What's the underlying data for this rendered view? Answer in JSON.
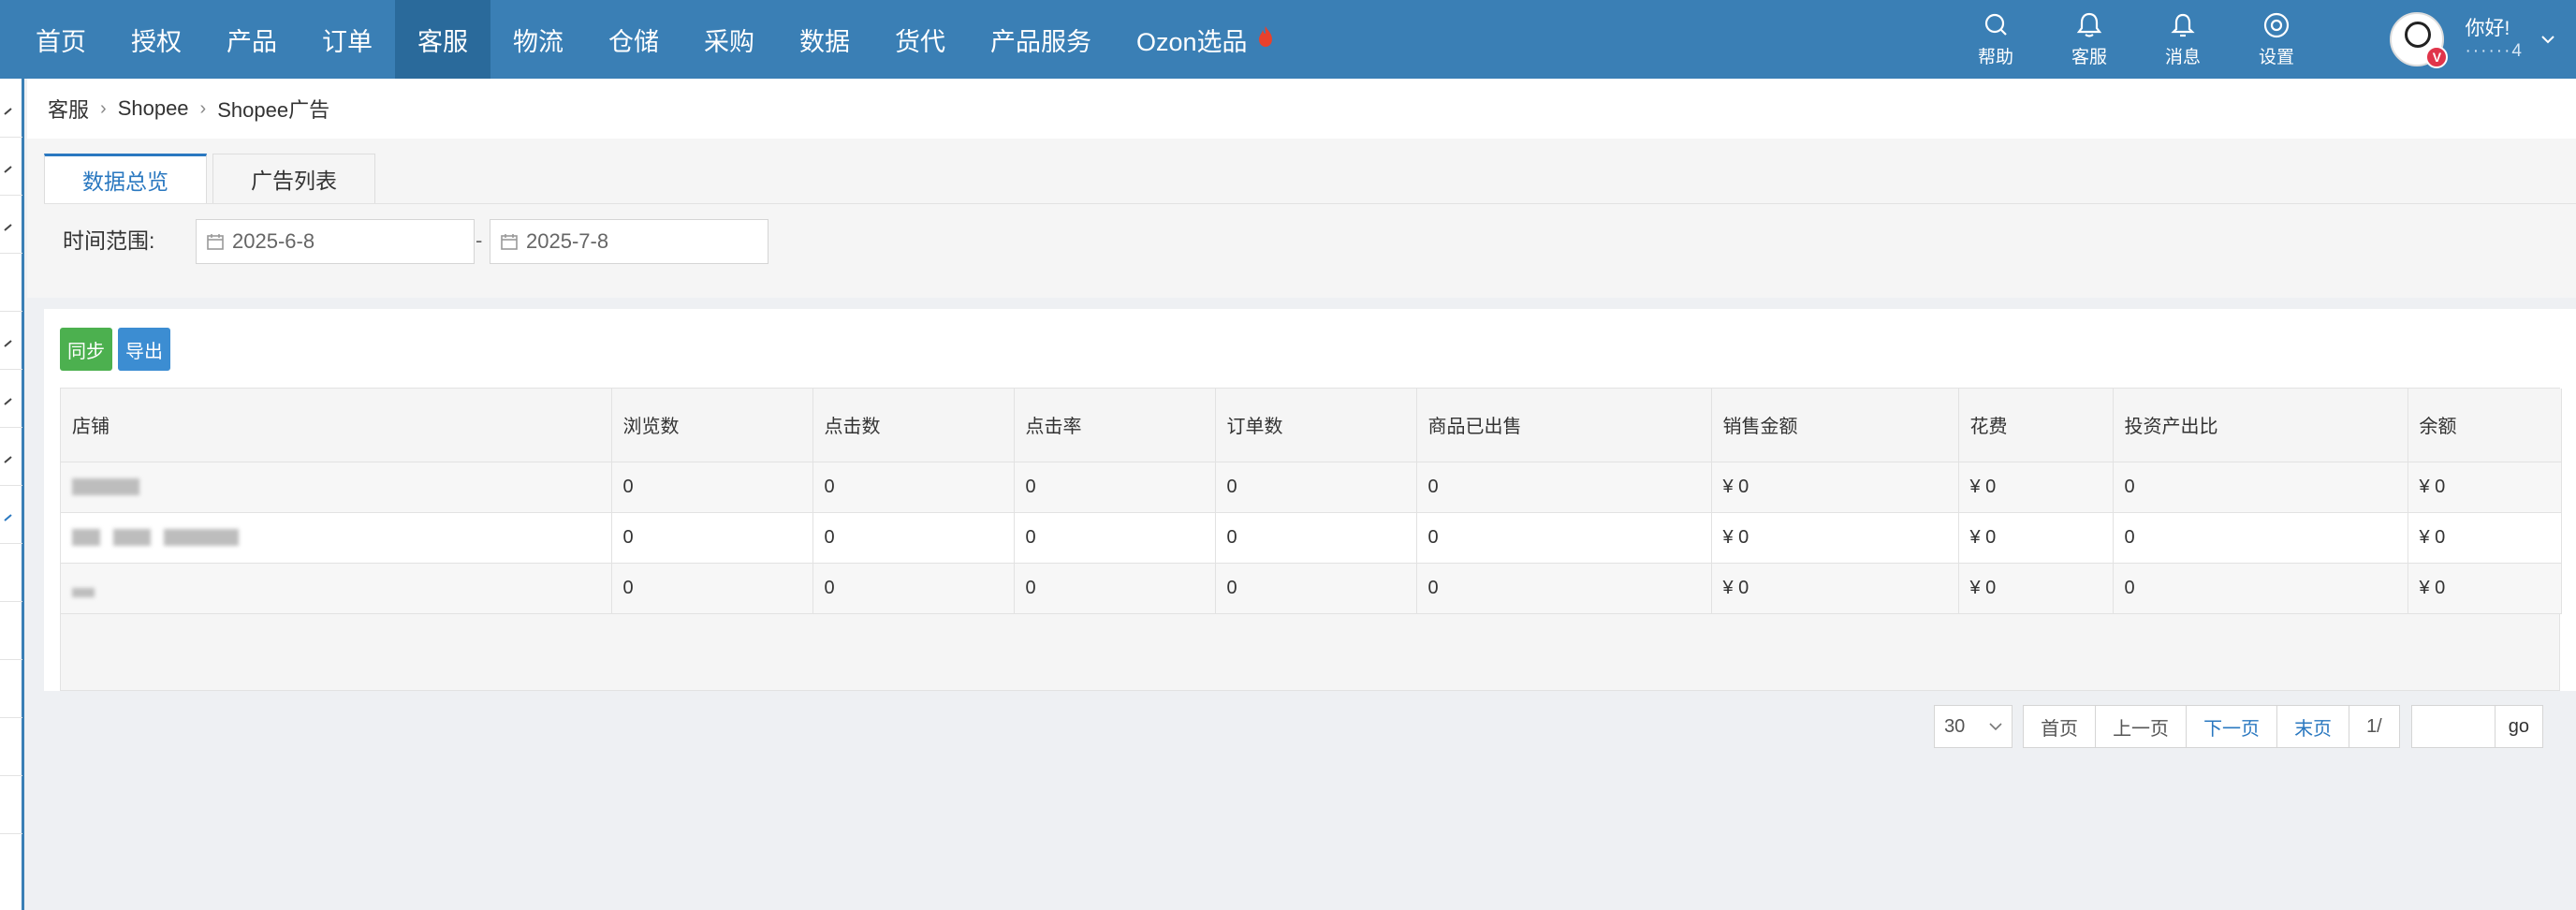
{
  "nav": {
    "items": [
      "首页",
      "授权",
      "产品",
      "订单",
      "客服",
      "物流",
      "仓储",
      "采购",
      "数据",
      "货代",
      "产品服务",
      "Ozon选品"
    ],
    "active_index": 4
  },
  "tools": [
    {
      "label": "帮助",
      "icon": "search-icon"
    },
    {
      "label": "客服",
      "icon": "bell-chat-icon"
    },
    {
      "label": "消息",
      "icon": "bell-icon"
    },
    {
      "label": "设置",
      "icon": "gear-icon"
    }
  ],
  "user": {
    "greeting": "你好!",
    "name": "······4",
    "badge": "V"
  },
  "breadcrumb": [
    "客服",
    "Shopee",
    "Shopee广告"
  ],
  "tabs": [
    "数据总览",
    "广告列表"
  ],
  "filter": {
    "label": "时间范围:",
    "start": "2025-6-8",
    "end": "2025-7-8",
    "dash": "-"
  },
  "buttons": {
    "sync": "同步",
    "export": "导出"
  },
  "table": {
    "headers": [
      "店铺",
      "浏览数",
      "点击数",
      "点击率",
      "订单数",
      "商品已出售",
      "销售金额",
      "花费",
      "投资产出比",
      "余额"
    ],
    "rows": [
      [
        "",
        "0",
        "0",
        "0",
        "0",
        "0",
        "¥ 0",
        "¥ 0",
        "0",
        "¥ 0"
      ],
      [
        "",
        "0",
        "0",
        "0",
        "0",
        "0",
        "¥ 0",
        "¥ 0",
        "0",
        "¥ 0"
      ],
      [
        "",
        "0",
        "0",
        "0",
        "0",
        "0",
        "¥ 0",
        "¥ 0",
        "0",
        "¥ 0"
      ]
    ]
  },
  "pager": {
    "page_size": "30",
    "first": "首页",
    "prev": "上一页",
    "next": "下一页",
    "last": "末页",
    "page_info": "1/",
    "go": "go"
  },
  "colors": {
    "nav_bg": "#3a7fb5",
    "nav_active": "#2a6a9b",
    "link": "#2a78c0",
    "sync_btn": "#4cb04f",
    "export_btn": "#3c8dd2",
    "flame": "#e8412c"
  }
}
